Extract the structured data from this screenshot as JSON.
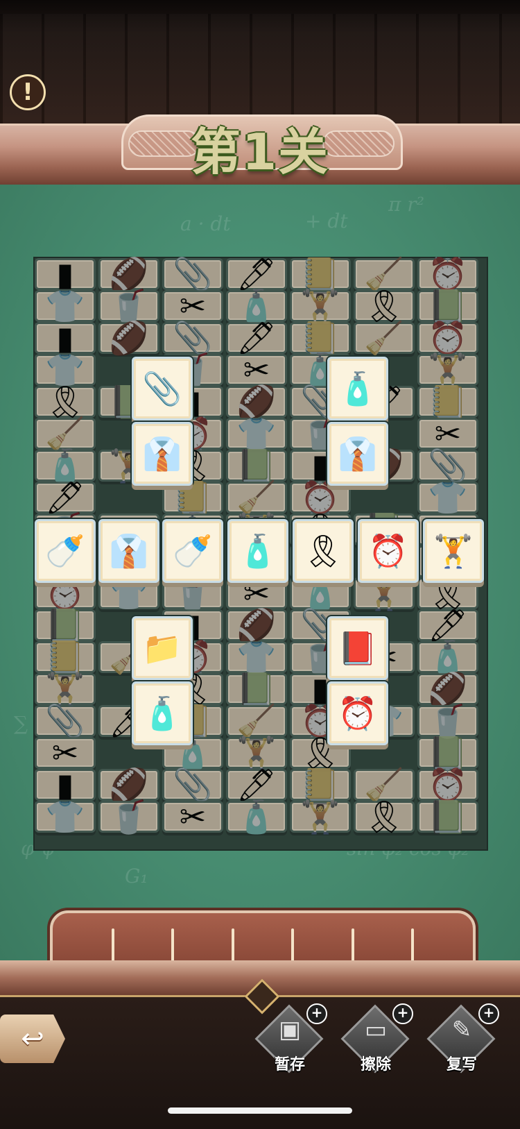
{
  "level": {
    "title": "第1关"
  },
  "info_button": {
    "glyph": "!"
  },
  "tiles_lit": [
    {
      "icon": "paperclip-icon",
      "glyph": "📎",
      "col": 0
    },
    {
      "icon": "toothpaste-icon",
      "glyph": "🧴",
      "col": 0
    },
    {
      "icon": "shirt-tie-icon",
      "glyph": "👔",
      "col": 0
    },
    {
      "icon": "shirt-tie-icon",
      "glyph": "👔",
      "col": 0
    },
    {
      "icon": "water-bottle-icon",
      "glyph": "🍼",
      "col": 0
    },
    {
      "icon": "shirt-tie-icon",
      "glyph": "👔",
      "col": 0
    },
    {
      "icon": "water-bottle-icon",
      "glyph": "🍼",
      "col": 0
    },
    {
      "icon": "toothpaste-icon",
      "glyph": "🧴",
      "col": 0
    },
    {
      "icon": "tape-roll-icon",
      "glyph": "🎗",
      "col": 0
    },
    {
      "icon": "alarm-clock-icon",
      "glyph": "⏰",
      "col": 0
    },
    {
      "icon": "dumbbell-icon",
      "glyph": "🏋",
      "col": 0
    },
    {
      "icon": "file-folder-icon",
      "glyph": "📁",
      "col": 0
    },
    {
      "icon": "notebook-icon",
      "glyph": "📕",
      "col": 0
    },
    {
      "icon": "toothpaste-icon",
      "glyph": "🧴",
      "col": 0
    },
    {
      "icon": "alarm-clock-icon",
      "glyph": "⏰",
      "col": 0
    }
  ],
  "tray": {
    "slots": 7,
    "filled": 0
  },
  "tools": [
    {
      "name": "stash",
      "label": "暂存",
      "icon": "box-icon",
      "glyph": "▣"
    },
    {
      "name": "erase",
      "label": "擦除",
      "icon": "eraser-icon",
      "glyph": "▭"
    },
    {
      "name": "rewrite",
      "label": "复写",
      "icon": "chalk-icon",
      "glyph": "✎"
    }
  ],
  "tool_plus": "+",
  "back_button": {
    "glyph": "↩"
  }
}
